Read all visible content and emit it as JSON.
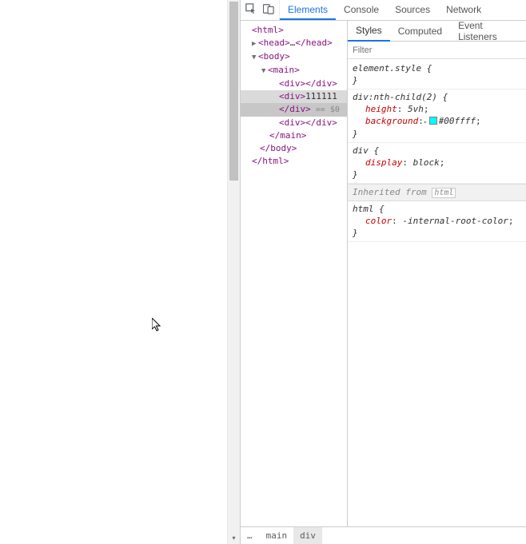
{
  "toolbar": {
    "tabs": {
      "elements": "Elements",
      "console": "Console",
      "sources": "Sources",
      "network": "Network"
    }
  },
  "dom": {
    "html_open": "<html>",
    "head_open": "<head>",
    "head_dots": "…",
    "head_close": "</head>",
    "body_open": "<body>",
    "main_open": "<main>",
    "div_pair": "<div></div>",
    "sel_open": "<div>",
    "sel_text": "111111",
    "sel_close": "</div>",
    "eq_marker": " == $0",
    "main_close": "</main>",
    "body_close": "</body>",
    "html_close": "</html>",
    "gutter_dots": "•••"
  },
  "breadcrumb": {
    "dots": "…",
    "main": "main",
    "div": "div"
  },
  "sub_tabs": {
    "styles": "Styles",
    "computed": "Computed",
    "event_listeners": "Event Listeners"
  },
  "filter": {
    "placeholder": "Filter"
  },
  "rules": {
    "r0": {
      "selector": "element.style",
      "open_brace": " {",
      "close_brace": "}"
    },
    "r1": {
      "selector": "div:nth-child(2)",
      "open_brace": " {",
      "d0": {
        "prop": "height",
        "val": "5vh"
      },
      "d1": {
        "prop": "background",
        "hex": "#00ffff"
      },
      "close_brace": "}"
    },
    "r2": {
      "selector": "div",
      "open_brace": " {",
      "d0": {
        "prop": "display",
        "val": "block"
      },
      "close_brace": "}"
    },
    "inh_label": "Inherited from",
    "inh_link": "html",
    "r3": {
      "selector": "html",
      "open_brace": " {",
      "d0": {
        "prop": "color",
        "val": "-internal-root-color"
      },
      "close_brace": "}"
    }
  }
}
